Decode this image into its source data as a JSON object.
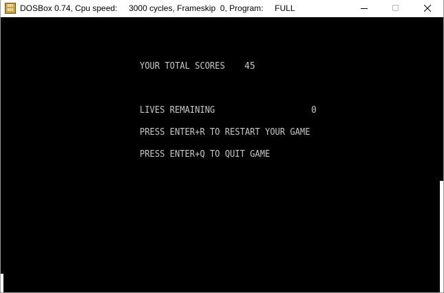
{
  "window": {
    "title": "DOSBox 0.74, Cpu speed:     3000 cycles, Frameskip  0, Program:     FULL",
    "icon": "dosbox-icon",
    "icon_text": "DOS BOX"
  },
  "controls": {
    "minimize": "minimize-icon",
    "maximize": "maximize-icon",
    "close": "close-icon"
  },
  "screen": {
    "score_label": "YOUR TOTAL SCORES",
    "score_value": "45",
    "lives_label": "LIVES REMAINING",
    "lives_value": "0",
    "restart_text": "PRESS ENTER+R TO RESTART YOUR GAME",
    "quit_text": "PRESS ENTER+Q TO QUIT GAME"
  },
  "colors": {
    "screen_bg": "#000000",
    "text": "#c8c8c8"
  }
}
